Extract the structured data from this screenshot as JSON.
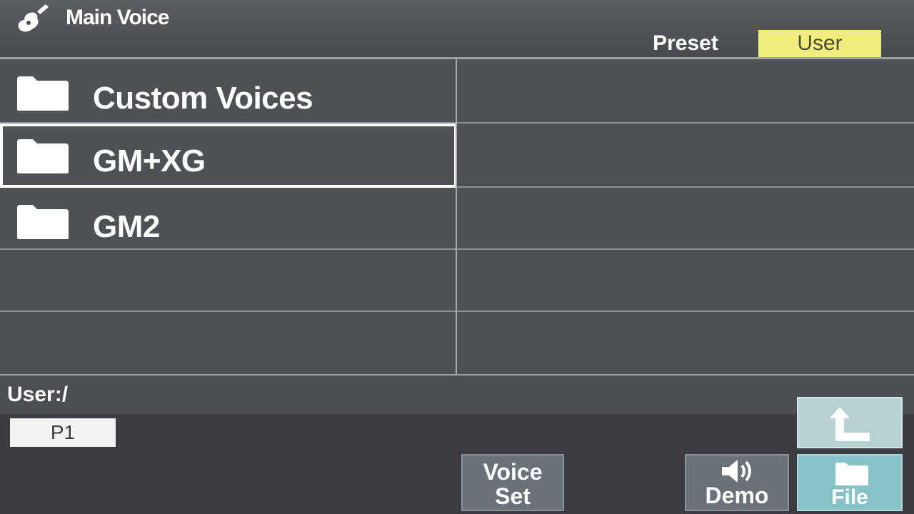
{
  "header": {
    "title": "Main Voice",
    "title_icon": "guitar-icon",
    "tabs": [
      {
        "label": "Preset",
        "active": false
      },
      {
        "label": "User",
        "active": true
      }
    ],
    "active_tab_color": "#f2ee7c"
  },
  "grid": {
    "left": [
      {
        "label": "Custom Voices",
        "icon": "folder-icon",
        "selected": false
      },
      {
        "label": "GM+XG",
        "icon": "folder-icon",
        "selected": true
      },
      {
        "label": "GM2",
        "icon": "folder-icon",
        "selected": false
      },
      {
        "label": "",
        "icon": "",
        "selected": false
      },
      {
        "label": "",
        "icon": "",
        "selected": false
      }
    ],
    "right": [
      "",
      "",
      "",
      "",
      ""
    ]
  },
  "path": "User:/",
  "page": "P1",
  "buttons": {
    "voice_set_line1": "Voice",
    "voice_set_line2": "Set",
    "demo": "Demo",
    "demo_icon": "speaker-icon",
    "up_icon": "up-arrow-icon",
    "file": "File",
    "file_icon": "folder-icon"
  }
}
